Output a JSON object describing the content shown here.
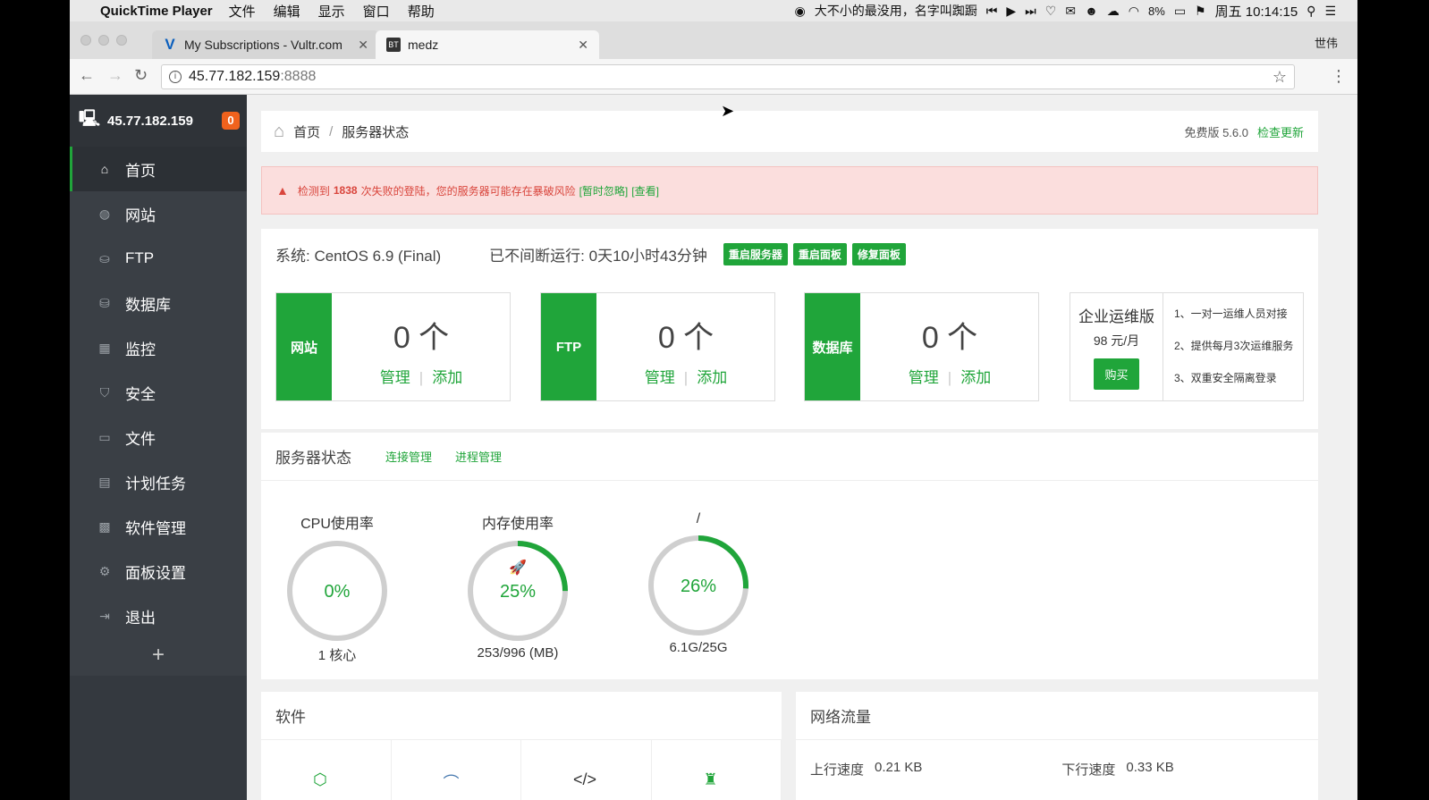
{
  "menubar": {
    "app": "QuickTime Player",
    "menus": [
      "文件",
      "编辑",
      "显示",
      "窗口",
      "帮助"
    ],
    "now_playing": "大不小的最没用，名字叫踟蹰",
    "battery": "8%",
    "clock": "周五 10:14:15"
  },
  "browser": {
    "tabs": [
      {
        "title": "My Subscriptions - Vultr.com"
      },
      {
        "title": "medz"
      }
    ],
    "profile": "世伟",
    "url_host": "45.77.182.159",
    "url_port": ":8888"
  },
  "sidebar": {
    "host": "45.77.182.159",
    "badge": "0",
    "items": [
      {
        "label": "首页"
      },
      {
        "label": "网站"
      },
      {
        "label": "FTP"
      },
      {
        "label": "数据库"
      },
      {
        "label": "监控"
      },
      {
        "label": "安全"
      },
      {
        "label": "文件"
      },
      {
        "label": "计划任务"
      },
      {
        "label": "软件管理"
      },
      {
        "label": "面板设置"
      },
      {
        "label": "退出"
      }
    ],
    "add": "+"
  },
  "breadcrumb": {
    "home": "首页",
    "sep": "/",
    "current": "服务器状态",
    "version": "免费版 5.6.0",
    "check_update": "检查更新"
  },
  "alert": {
    "prefix": "检测到",
    "count": "1838",
    "text": "次失败的登陆，您的服务器可能存在暴破风险",
    "ignore": "[暂时忽略]",
    "view": "[查看]"
  },
  "system": {
    "os": "系统: CentOS 6.9 (Final)",
    "uptime": "已不间断运行: 0天10小时43分钟",
    "buttons": [
      "重启服务器",
      "重启面板",
      "修复面板"
    ]
  },
  "stats": [
    {
      "label": "网站",
      "count": "0 个",
      "manage": "管理",
      "add": "添加"
    },
    {
      "label": "FTP",
      "count": "0 个",
      "manage": "管理",
      "add": "添加"
    },
    {
      "label": "数据库",
      "count": "0 个",
      "manage": "管理",
      "add": "添加"
    }
  ],
  "enterprise": {
    "title": "企业运维版",
    "price": "98 元/月",
    "buy": "购买",
    "features": [
      "1、一对一运维人员对接",
      "2、提供每月3次运维服务",
      "3、双重安全隔离登录"
    ]
  },
  "server_status": {
    "title": "服务器状态",
    "links": [
      "连接管理",
      "进程管理"
    ],
    "gauges": [
      {
        "title": "CPU使用率",
        "percent": 0,
        "value": "0%",
        "detail": "1 核心"
      },
      {
        "title": "内存使用率",
        "percent": 25,
        "value": "25%",
        "detail": "253/996 (MB)"
      },
      {
        "title": "/",
        "percent": 26,
        "value": "26%",
        "detail": "6.1G/25G"
      }
    ]
  },
  "software": {
    "title": "软件"
  },
  "network": {
    "title": "网络流量",
    "up_label": "上行速度",
    "up_value": "0.21 KB",
    "down_label": "下行速度",
    "down_value": "0.33 KB"
  },
  "colors": {
    "accent": "#20a53a",
    "sidebar": "#3a3f45",
    "alert": "#d9453c",
    "badge": "#f0621d"
  }
}
